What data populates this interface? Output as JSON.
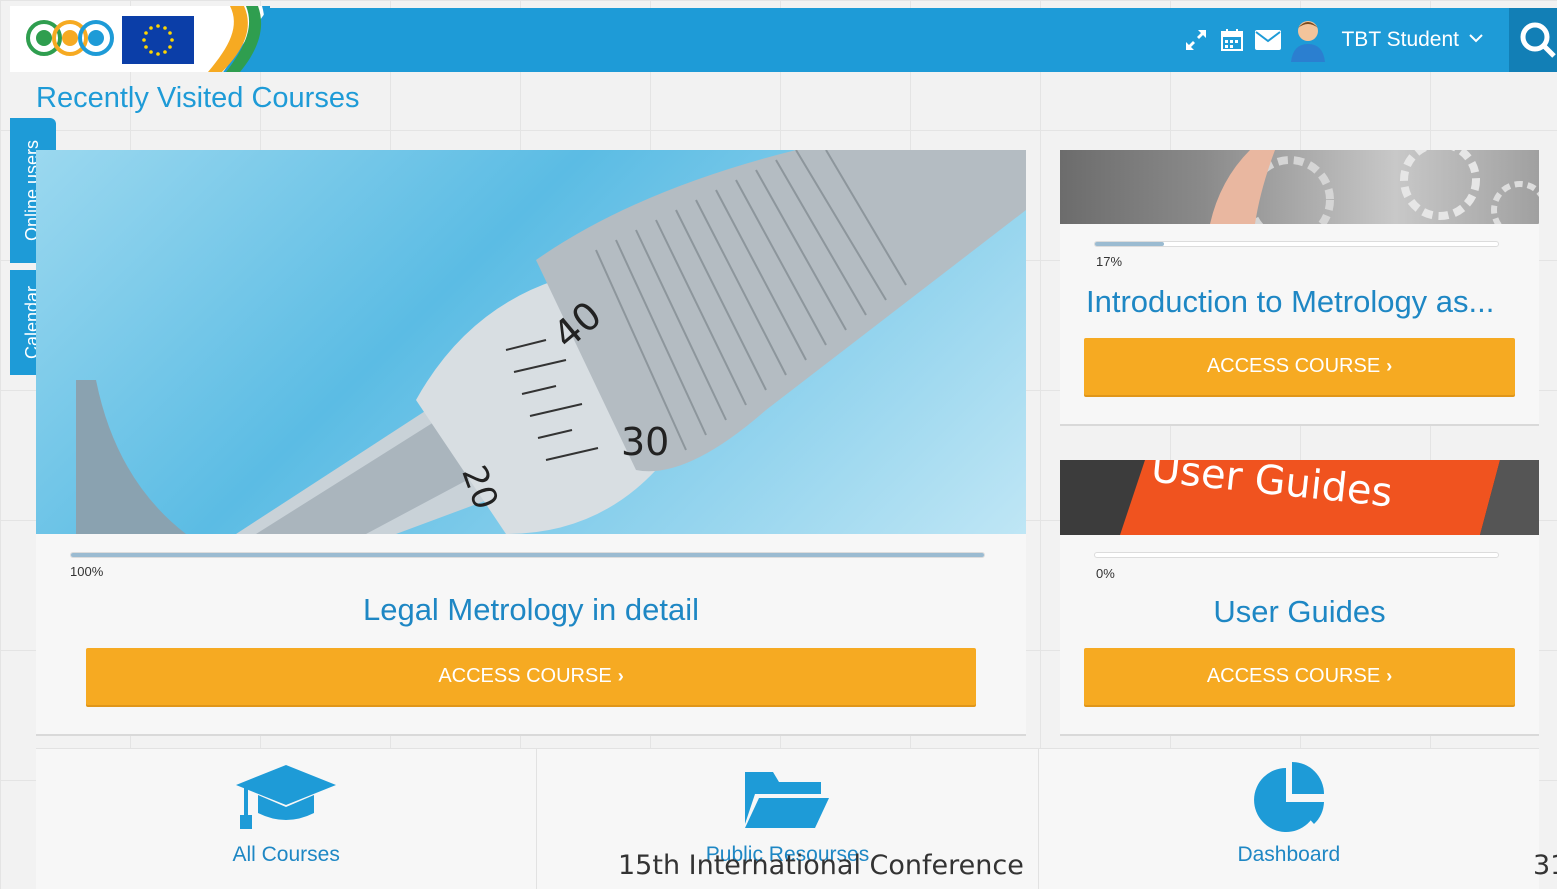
{
  "header": {
    "user_name": "TBT Student",
    "icons": [
      "expand-icon",
      "calendar-icon",
      "mail-icon",
      "user-avatar-icon",
      "chevron-down-icon",
      "search-icon"
    ],
    "colors": {
      "primary": "#1e9bd7",
      "accent": "#f6aa22"
    }
  },
  "side_tabs": {
    "online_users": "Online users",
    "calendar": "Calendar"
  },
  "section": {
    "title": "Recently Visited Courses"
  },
  "courses": [
    {
      "title": "Legal Metrology in detail",
      "progress_text": "100%",
      "progress": 100,
      "button": "ACCESS COURSE"
    },
    {
      "title": "Introduction to Metrology as...",
      "progress_text": "17%",
      "progress": 17,
      "button": "ACCESS COURSE"
    },
    {
      "title": "User Guides",
      "progress_text": "0%",
      "progress": 0,
      "button": "ACCESS COURSE",
      "image_text": "User Guides"
    }
  ],
  "bottom_nav": [
    {
      "label": "All Courses",
      "icon": "graduation-cap-icon"
    },
    {
      "label": "Public Resourses",
      "icon": "folder-open-icon"
    },
    {
      "label": "Dashboard",
      "icon": "pie-chart-icon"
    }
  ],
  "micrometer_numbers": [
    "40",
    "30",
    "20"
  ],
  "footer": {
    "conference": "15th International Conference",
    "slide_number": "31"
  }
}
